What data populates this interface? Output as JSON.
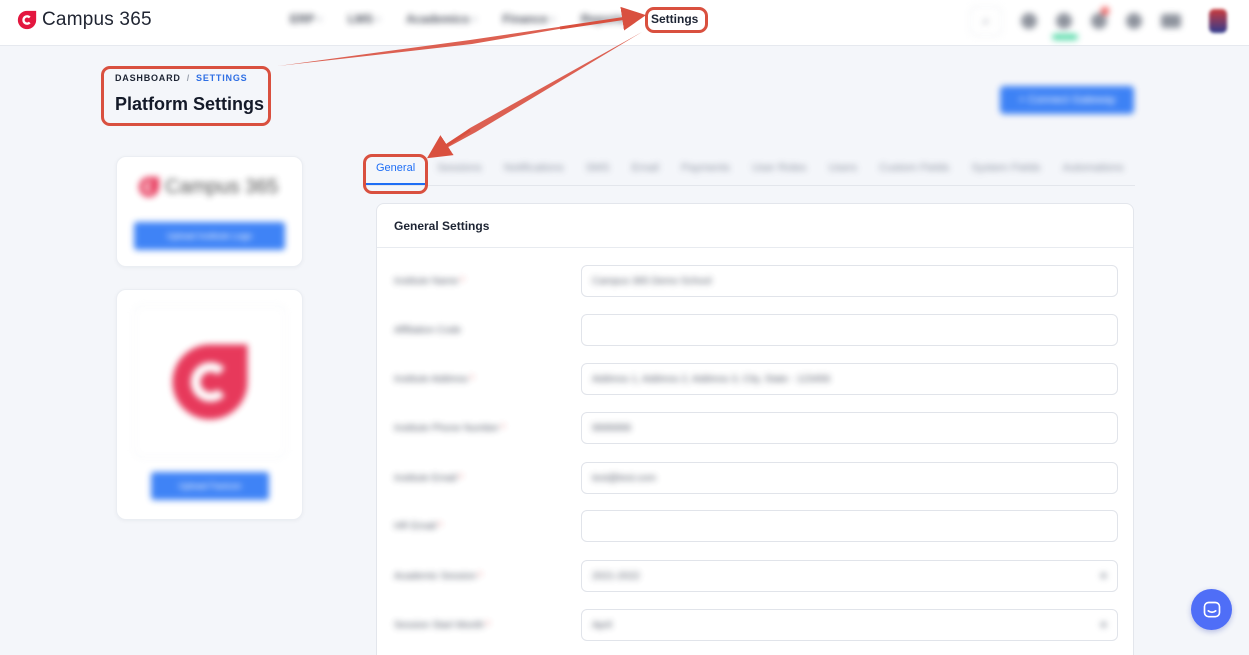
{
  "app": {
    "name": "Campus 365",
    "brand_color": "#e3173f",
    "accent_color": "#1e6ef5",
    "annotation_color": "#d9503f"
  },
  "topnav": {
    "items": [
      {
        "label": "ERP"
      },
      {
        "label": "LMS"
      },
      {
        "label": "Academics"
      },
      {
        "label": "Finance"
      },
      {
        "label": "Reports"
      }
    ],
    "settings_label": "Settings",
    "icons": [
      "search-icon",
      "globe-icon",
      "user-status-icon",
      "bell-icon",
      "help-icon",
      "language-flag-icon",
      "avatar"
    ]
  },
  "breadcrumb": {
    "root": "DASHBOARD",
    "separator": "/",
    "current": "SETTINGS"
  },
  "page": {
    "title": "Platform Settings",
    "primary_action": "+ Connect Gateway"
  },
  "left": {
    "logo_text": "Campus 365",
    "upload_logo_label": "Upload Institute Logo",
    "upload_favicon_label": "Upload Favicon"
  },
  "tabs": [
    {
      "label": "General"
    },
    {
      "label": "Sessions"
    },
    {
      "label": "Notifications"
    },
    {
      "label": "SMS"
    },
    {
      "label": "Email"
    },
    {
      "label": "Payments"
    },
    {
      "label": "User Roles"
    },
    {
      "label": "Users"
    },
    {
      "label": "Custom Fields"
    },
    {
      "label": "System Fields"
    },
    {
      "label": "Automations"
    }
  ],
  "form": {
    "section_title": "General Settings",
    "fields": [
      {
        "label": "Institute Name",
        "required": "*",
        "value": "Campus 365 Demo School"
      },
      {
        "label": "Affiliation Code",
        "required": "",
        "value": ""
      },
      {
        "label": "Institute Address",
        "required": "*",
        "value": "Address 1, Address 2, Address 3, City, State - 123456"
      },
      {
        "label": "Institute Phone Number",
        "required": "*",
        "value": "9999999"
      },
      {
        "label": "Institute Email",
        "required": "*",
        "value": "test@test.com"
      },
      {
        "label": "HR Email",
        "required": "*",
        "value": ""
      },
      {
        "label": "Academic Session",
        "required": "*",
        "value": "2021-2022"
      },
      {
        "label": "Session Start Month",
        "required": "*",
        "value": "April"
      }
    ]
  }
}
